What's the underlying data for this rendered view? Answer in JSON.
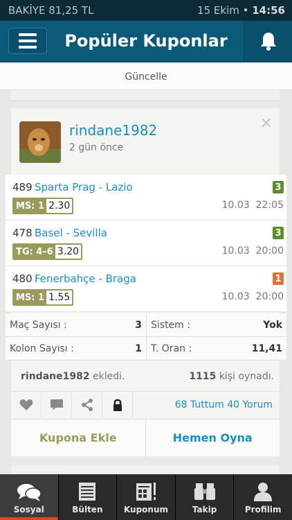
{
  "status": {
    "balance": "BAKİYE 81,25 TL",
    "date": "15 Ekim",
    "time": "14:56"
  },
  "header": {
    "title": "Popüler Kuponlar"
  },
  "refresh_label": "Güncelle",
  "coupon": {
    "username": "rindane1982",
    "time_ago": "2 gün önce",
    "matches": [
      {
        "code": "489",
        "teams": "Sparta Prag - Lazio",
        "pick_type": "MS: 1",
        "odds": "2.30",
        "date": "10.03",
        "time": "22:05",
        "badge": "3",
        "badge_color": "#5c8f2b"
      },
      {
        "code": "478",
        "teams": "Basel - Sevilla",
        "pick_type": "TG: 4–6",
        "odds": "3.20",
        "date": "10.03",
        "time": "20:00",
        "badge": "3",
        "badge_color": "#5c8f2b"
      },
      {
        "code": "480",
        "teams": "Fenerbahçe - Braga",
        "pick_type": "MS: 1",
        "odds": "1.55",
        "date": "10.03",
        "time": "20:00",
        "badge": "1",
        "badge_color": "#e2703a"
      }
    ],
    "stats": {
      "match_count_label": "Maç Sayısı :",
      "match_count": "3",
      "system_label": "Sistem :",
      "system": "Yok",
      "column_count_label": "Kolon Sayısı :",
      "column_count": "1",
      "total_odds_label": "T. Oran :",
      "total_odds": "11,41"
    },
    "added_by": "rindane1982",
    "added_text": "ekledi.",
    "played_count": "1115",
    "played_text": "kişi oynadı.",
    "engagement": "68 Tuttum 40 Yorum",
    "add_button": "Kupona Ekle",
    "play_button": "Hemen Oyna"
  },
  "tabs": [
    {
      "label": "Sosyal",
      "icon": "chat-bubbles-icon",
      "active": true
    },
    {
      "label": "Bülten",
      "icon": "list-icon",
      "active": false
    },
    {
      "label": "Kuponum",
      "icon": "coupon-icon",
      "active": false
    },
    {
      "label": "Takip",
      "icon": "binoculars-icon",
      "active": false
    },
    {
      "label": "Profilim",
      "icon": "person-icon",
      "active": false
    }
  ]
}
